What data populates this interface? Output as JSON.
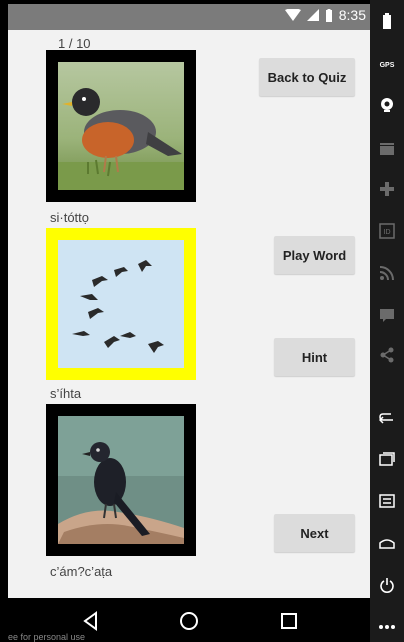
{
  "status": {
    "time": "8:35"
  },
  "quiz": {
    "counter": "1 / 10",
    "words": [
      "si·tóttọ",
      "s’íhta",
      "c’ám?c’aṭa"
    ],
    "back_label": "Back to Quiz",
    "play_label": "Play Word",
    "hint_label": "Hint",
    "next_label": "Next",
    "selected_index": 1
  },
  "images": {
    "first": "robin-photo",
    "second": "geese-flock-photo",
    "third": "blackbird-photo"
  },
  "sidebar": {
    "gps_label": "GPS"
  },
  "colors": {
    "selected_frame": "#ffff00",
    "frame": "#000000",
    "screen_bg": "#f2f2f2"
  },
  "footer": {
    "watermark": "ee for personal use"
  }
}
